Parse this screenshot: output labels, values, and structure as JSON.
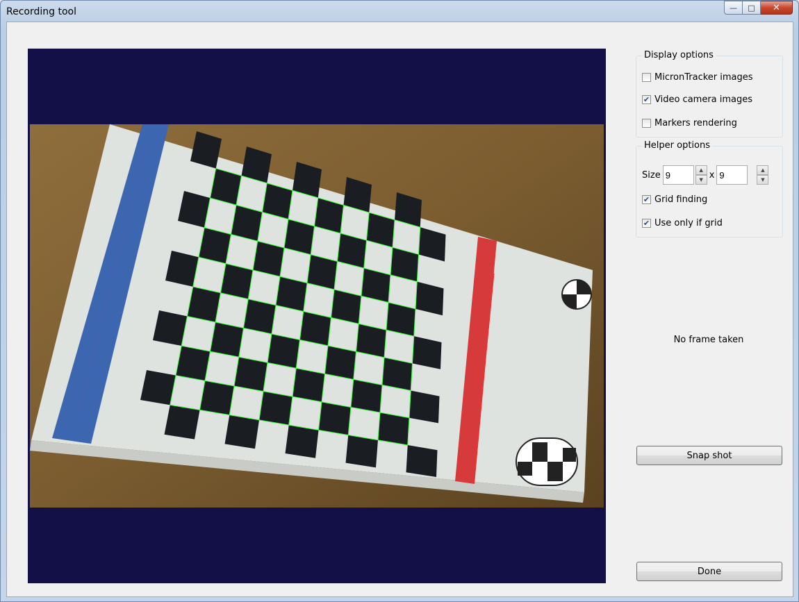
{
  "window": {
    "title": "Recording tool"
  },
  "display_options": {
    "title": "Display options",
    "items": [
      {
        "label": "MicronTracker images",
        "checked": false
      },
      {
        "label": "Video camera images",
        "checked": true
      },
      {
        "label": "Markers rendering",
        "checked": false
      }
    ]
  },
  "helper_options": {
    "title": "Helper options",
    "size_label": "Size",
    "size_x": "9",
    "size_sep": "x",
    "size_y": "9",
    "items": [
      {
        "label": "Grid finding",
        "checked": true
      },
      {
        "label": "Use only if grid",
        "checked": true
      }
    ]
  },
  "status_text": "No frame taken",
  "buttons": {
    "snapshot": "Snap shot",
    "done": "Done"
  },
  "colors": {
    "viewer_bg": "#130f47",
    "table_wood": "#7a5c30",
    "board": "#e2e6e3",
    "square": "#1a1e22",
    "grid_line": "#39ff39",
    "blue_strip": "#3c67b0",
    "red_strip": "#d63a3a"
  }
}
